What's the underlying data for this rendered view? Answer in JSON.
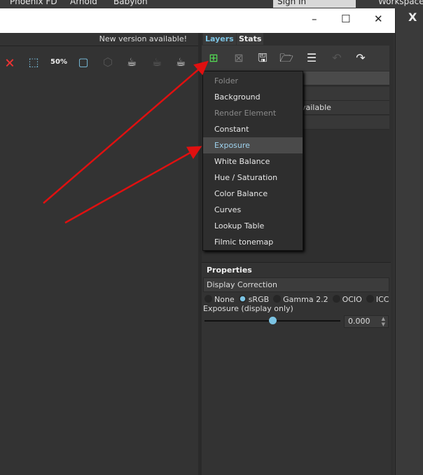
{
  "menubar": {
    "items": [
      "Phoenix FD",
      "Arnold",
      "Babylon"
    ],
    "signin": "Sign In",
    "workspaces": "Workspaces:",
    "close_x": "X"
  },
  "window": {
    "minimize": "–",
    "maximize": "☐",
    "close": "✕"
  },
  "left": {
    "new_version": "New version available!",
    "toolbar_icons": [
      "clear-icon",
      "region-select-icon",
      "zoom-50-icon",
      "frame-icon",
      "track-mouse-icon",
      "render-teapot-play-icon",
      "teapot-disabled-icon",
      "teapot-icon"
    ],
    "zoom_label": "50%"
  },
  "tabs": {
    "layers": "Layers",
    "stats": "Stats"
  },
  "layer_toolbar": [
    "add-layer-icon",
    "delete-layer-icon",
    "save-layers-icon",
    "load-layers-icon",
    "layer-list-icon",
    "undo-icon",
    "redo-icon"
  ],
  "layer_rows": {
    "available_text": "vailable"
  },
  "menu": {
    "items": [
      {
        "label": "Folder",
        "disabled": true
      },
      {
        "label": "Background",
        "disabled": false
      },
      {
        "label": "Render Element",
        "disabled": true
      },
      {
        "label": "Constant",
        "disabled": false
      },
      {
        "label": "Exposure",
        "disabled": false,
        "highlighted": true
      },
      {
        "label": "White Balance",
        "disabled": false
      },
      {
        "label": "Hue / Saturation",
        "disabled": false
      },
      {
        "label": "Color Balance",
        "disabled": false
      },
      {
        "label": "Curves",
        "disabled": false
      },
      {
        "label": "Lookup Table",
        "disabled": false
      },
      {
        "label": "Filmic tonemap",
        "disabled": false
      }
    ]
  },
  "properties": {
    "title": "Properties",
    "section": "Display Correction",
    "radios": [
      {
        "label": "None",
        "on": false
      },
      {
        "label": "sRGB",
        "on": true
      },
      {
        "label": "Gamma 2.2",
        "on": false
      },
      {
        "label": "OCIO",
        "on": false
      },
      {
        "label": "ICC",
        "on": false
      }
    ],
    "exposure_label": "Exposure (display only)",
    "exposure_value": "0.000",
    "exposure_slider_fraction": 0.5
  },
  "colors": {
    "accent": "#7cc4e4",
    "annotation_arrow": "#e01010"
  }
}
